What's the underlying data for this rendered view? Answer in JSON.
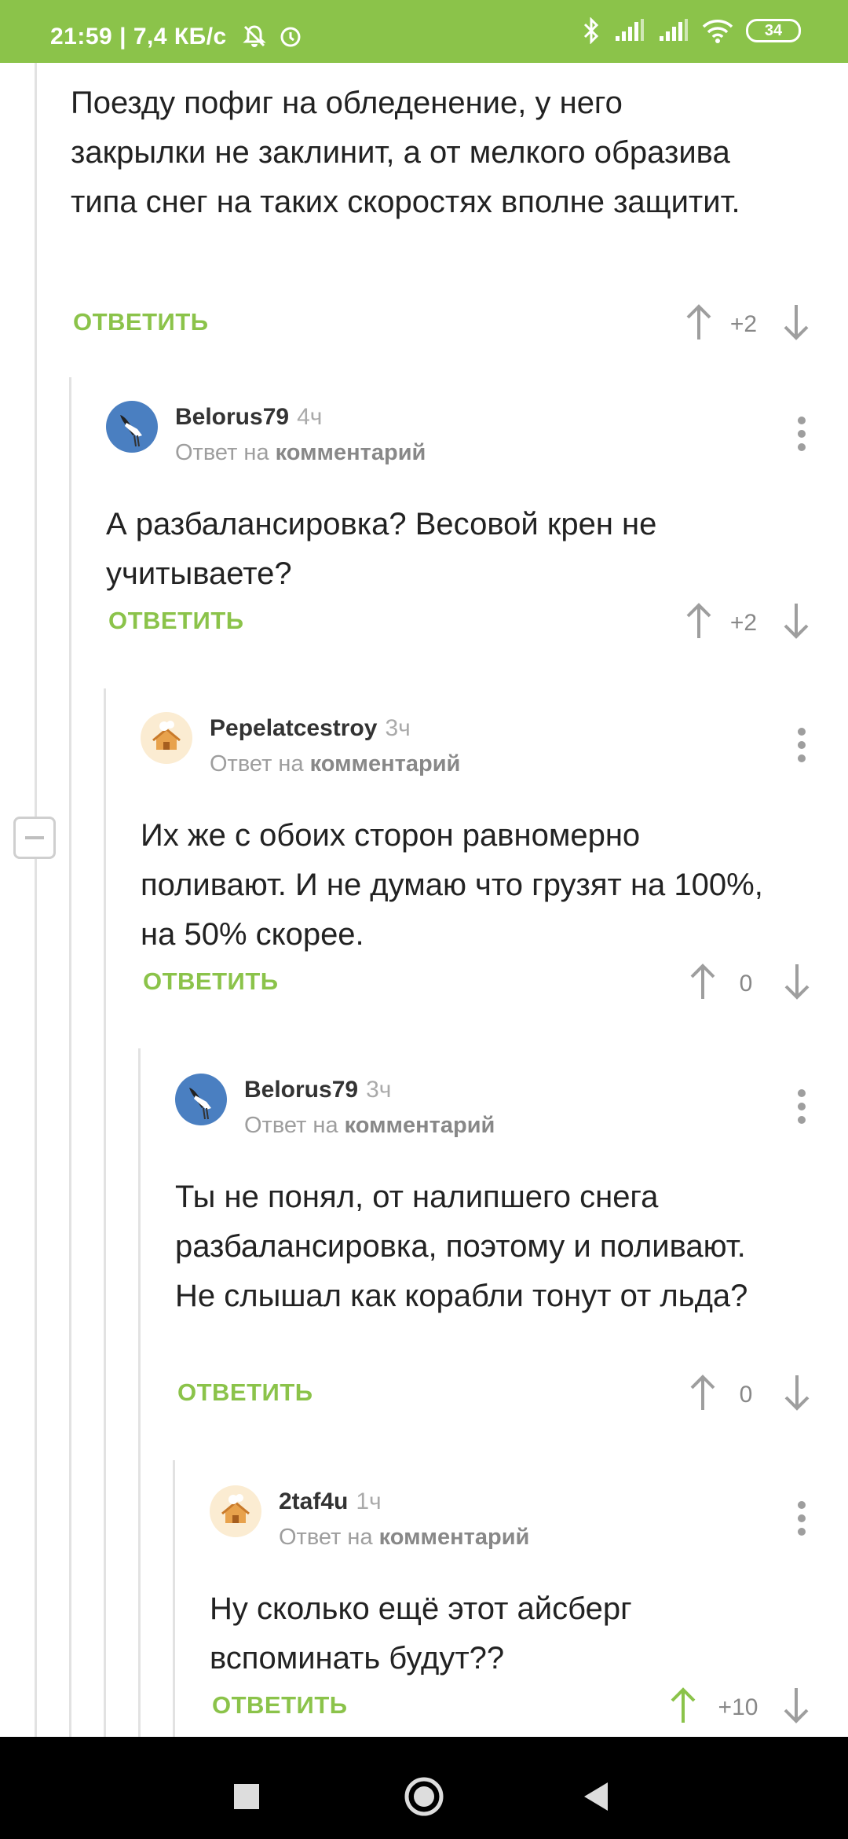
{
  "status_bar": {
    "time": "21:59",
    "network_speed": "7,4 КБ/с",
    "battery": "34",
    "bar_color": "#8bc34a"
  },
  "accent_color": "#8bc34a",
  "comments": [
    {
      "body": "Поезду пофиг на обледенение, у него закрылки не заклинит, а от мелкого образива типа снег на таких скоростях вполне защитит.",
      "reply_label": "ОТВЕТИТЬ",
      "score": "+2"
    },
    {
      "author": "Belorus79",
      "age": "4ч",
      "reply_to_prefix": "Ответ на",
      "reply_to_link": "комментарий",
      "avatar": "stork-avatar",
      "body": "А разбалансировка? Весовой крен не учитываете?",
      "reply_label": "ОТВЕТИТЬ",
      "score": "+2"
    },
    {
      "author": "Pepelatcestroy",
      "age": "3ч",
      "reply_to_prefix": "Ответ на",
      "reply_to_link": "комментарий",
      "avatar": "house-avatar",
      "body": "Их же с обоих сторон равномерно поливают. И не думаю что грузят на 100%, на 50% скорее.",
      "reply_label": "ОТВЕТИТЬ",
      "score": "0"
    },
    {
      "author": "Belorus79",
      "age": "3ч",
      "reply_to_prefix": "Ответ на",
      "reply_to_link": "комментарий",
      "avatar": "stork-avatar",
      "body": "Ты не понял, от налипшего снега разбалансировка, поэтому и поливают. Не слышал как корабли тонут от льда?",
      "reply_label": "ОТВЕТИТЬ",
      "score": "0"
    },
    {
      "author": "2taf4u",
      "age": "1ч",
      "reply_to_prefix": "Ответ на",
      "reply_to_link": "комментарий",
      "avatar": "house-avatar",
      "body": "Ну сколько ещё этот айсберг вспоминать будут??",
      "reply_label": "ОТВЕТИТЬ",
      "score": "+10",
      "upvoted": true
    }
  ],
  "nav_bar": {
    "buttons": [
      "recents-icon",
      "home-icon",
      "back-icon"
    ]
  }
}
